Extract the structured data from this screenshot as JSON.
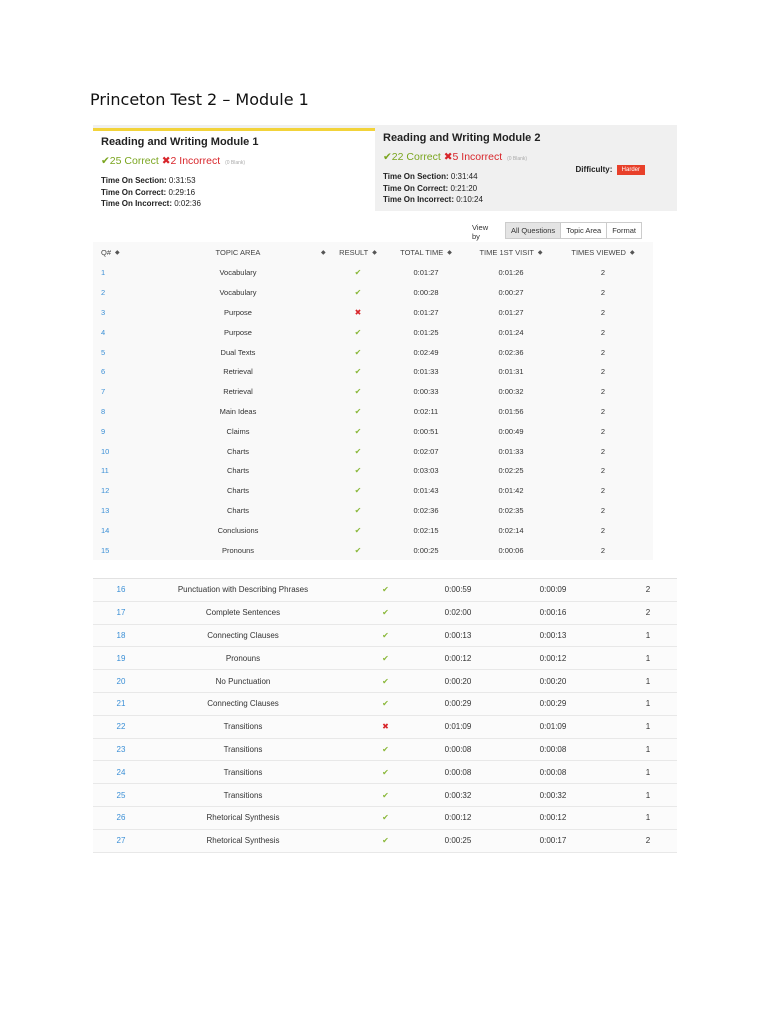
{
  "page_title": "Princeton Test 2 – Module 1",
  "modules": [
    {
      "title": "Reading and Writing Module 1",
      "correct": "✔25 Correct",
      "incorrect": "✖2 Incorrect",
      "blank": "(0 Blank)",
      "stats": [
        {
          "label": "Time On Section:",
          "value": "0:31:53"
        },
        {
          "label": "Time On Correct:",
          "value": "0:29:16"
        },
        {
          "label": "Time On Incorrect:",
          "value": "0:02:36"
        }
      ]
    },
    {
      "title": "Reading and Writing Module 2",
      "correct": "✔22 Correct",
      "incorrect": "✖5 Incorrect",
      "blank": "(0 Blank)",
      "stats": [
        {
          "label": "Time On Section:",
          "value": "0:31:44"
        },
        {
          "label": "Time On Correct:",
          "value": "0:21:20"
        },
        {
          "label": "Time On Incorrect:",
          "value": "0:10:24"
        }
      ],
      "difficulty_label": "Difficulty:",
      "difficulty_value": "Harder"
    }
  ],
  "view_by": {
    "label": "View by",
    "options": [
      "All Questions",
      "Topic Area",
      "Format"
    ],
    "selected": "All Questions"
  },
  "columns": {
    "q": "Q#",
    "topic": "TOPIC AREA",
    "result": "RESULT",
    "total": "TOTAL TIME",
    "first_visit": "TIME 1ST VISIT",
    "views": "TIMES VIEWED"
  },
  "colors": {
    "correct": "#8ab83a",
    "incorrect": "#d8262b",
    "link": "#3a8fd6",
    "active_tab_border": "#f2d33a",
    "difficulty_badge": "#e8402a"
  },
  "rows_top": [
    {
      "q": "1",
      "topic": "Vocabulary",
      "result": "correct",
      "total": "0:01:27",
      "first": "0:01:26",
      "views": "2"
    },
    {
      "q": "2",
      "topic": "Vocabulary",
      "result": "correct",
      "total": "0:00:28",
      "first": "0:00:27",
      "views": "2"
    },
    {
      "q": "3",
      "topic": "Purpose",
      "result": "incorrect",
      "total": "0:01:27",
      "first": "0:01:27",
      "views": "2"
    },
    {
      "q": "4",
      "topic": "Purpose",
      "result": "correct",
      "total": "0:01:25",
      "first": "0:01:24",
      "views": "2"
    },
    {
      "q": "5",
      "topic": "Dual Texts",
      "result": "correct",
      "total": "0:02:49",
      "first": "0:02:36",
      "views": "2"
    },
    {
      "q": "6",
      "topic": "Retrieval",
      "result": "correct",
      "total": "0:01:33",
      "first": "0:01:31",
      "views": "2"
    },
    {
      "q": "7",
      "topic": "Retrieval",
      "result": "correct",
      "total": "0:00:33",
      "first": "0:00:32",
      "views": "2"
    },
    {
      "q": "8",
      "topic": "Main Ideas",
      "result": "correct",
      "total": "0:02:11",
      "first": "0:01:56",
      "views": "2"
    },
    {
      "q": "9",
      "topic": "Claims",
      "result": "correct",
      "total": "0:00:51",
      "first": "0:00:49",
      "views": "2"
    },
    {
      "q": "10",
      "topic": "Charts",
      "result": "correct",
      "total": "0:02:07",
      "first": "0:01:33",
      "views": "2"
    },
    {
      "q": "11",
      "topic": "Charts",
      "result": "correct",
      "total": "0:03:03",
      "first": "0:02:25",
      "views": "2"
    },
    {
      "q": "12",
      "topic": "Charts",
      "result": "correct",
      "total": "0:01:43",
      "first": "0:01:42",
      "views": "2"
    },
    {
      "q": "13",
      "topic": "Charts",
      "result": "correct",
      "total": "0:02:36",
      "first": "0:02:35",
      "views": "2"
    },
    {
      "q": "14",
      "topic": "Conclusions",
      "result": "correct",
      "total": "0:02:15",
      "first": "0:02:14",
      "views": "2"
    },
    {
      "q": "15",
      "topic": "Pronouns",
      "result": "correct",
      "total": "0:00:25",
      "first": "0:00:06",
      "views": "2"
    }
  ],
  "rows_bottom": [
    {
      "q": "16",
      "topic": "Punctuation with Describing Phrases",
      "result": "correct",
      "total": "0:00:59",
      "first": "0:00:09",
      "views": "2"
    },
    {
      "q": "17",
      "topic": "Complete Sentences",
      "result": "correct",
      "total": "0:02:00",
      "first": "0:00:16",
      "views": "2"
    },
    {
      "q": "18",
      "topic": "Connecting Clauses",
      "result": "correct",
      "total": "0:00:13",
      "first": "0:00:13",
      "views": "1"
    },
    {
      "q": "19",
      "topic": "Pronouns",
      "result": "correct",
      "total": "0:00:12",
      "first": "0:00:12",
      "views": "1"
    },
    {
      "q": "20",
      "topic": "No Punctuation",
      "result": "correct",
      "total": "0:00:20",
      "first": "0:00:20",
      "views": "1"
    },
    {
      "q": "21",
      "topic": "Connecting Clauses",
      "result": "correct",
      "total": "0:00:29",
      "first": "0:00:29",
      "views": "1"
    },
    {
      "q": "22",
      "topic": "Transitions",
      "result": "incorrect",
      "total": "0:01:09",
      "first": "0:01:09",
      "views": "1"
    },
    {
      "q": "23",
      "topic": "Transitions",
      "result": "correct",
      "total": "0:00:08",
      "first": "0:00:08",
      "views": "1"
    },
    {
      "q": "24",
      "topic": "Transitions",
      "result": "correct",
      "total": "0:00:08",
      "first": "0:00:08",
      "views": "1"
    },
    {
      "q": "25",
      "topic": "Transitions",
      "result": "correct",
      "total": "0:00:32",
      "first": "0:00:32",
      "views": "1"
    },
    {
      "q": "26",
      "topic": "Rhetorical Synthesis",
      "result": "correct",
      "total": "0:00:12",
      "first": "0:00:12",
      "views": "1"
    },
    {
      "q": "27",
      "topic": "Rhetorical Synthesis",
      "result": "correct",
      "total": "0:00:25",
      "first": "0:00:17",
      "views": "2"
    }
  ]
}
